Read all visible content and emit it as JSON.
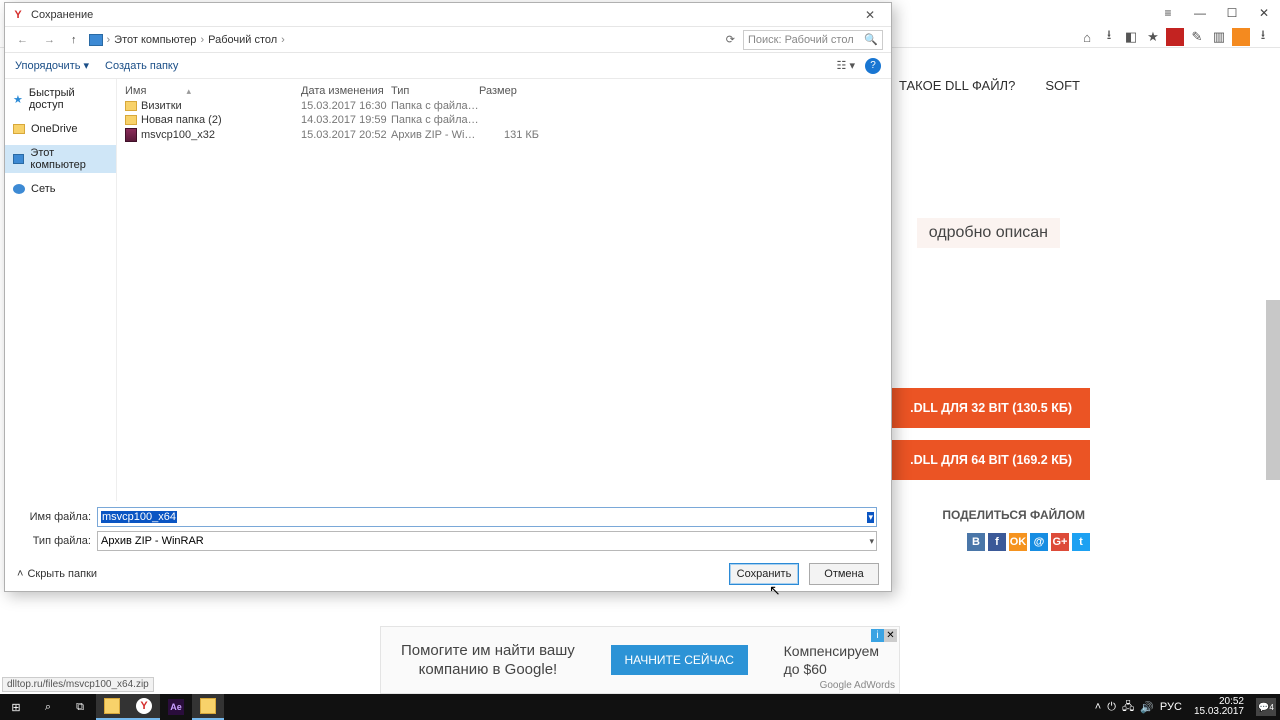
{
  "browser": {
    "controls": {
      "menu": "≡",
      "min": "—",
      "max": "☐",
      "close": "✕"
    },
    "page_nav": {
      "dll_file": "ТАКОЕ DLL ФАЙЛ?",
      "soft": "SOFT"
    },
    "page_desc": "одробно описан",
    "dl32": ".DLL ДЛЯ 32 BIT (130.5 КБ)",
    "dl64": ".DLL ДЛЯ 64 BIT (169.2 КБ)",
    "share_title": "ПОДЕЛИТЬСЯ ФАЙЛОМ",
    "status_url": "dlltop.ru/files/msvcp100_x64.zip"
  },
  "ad": {
    "line1": "Помогите им найти вашу",
    "line2": "компанию в Google!",
    "cta": "НАЧНИТЕ СЕЙЧАС",
    "right1": "Компенсируем",
    "right2": "до $60",
    "brand": "Google AdWords",
    "info": "i",
    "x": "✕"
  },
  "dialog": {
    "title": "Сохранение",
    "close": "✕",
    "nav_back": "←",
    "nav_fwd": "→",
    "nav_up": "↑",
    "refresh": "⟳",
    "crumb_pc": "Этот компьютер",
    "crumb_desktop": "Рабочий стол",
    "crumb_sep": "›",
    "search_placeholder": "Поиск: Рабочий стол",
    "search_icon": "🔍",
    "organize": "Упорядочить ▾",
    "newfolder": "Создать папку",
    "view_icon": "☷ ▾",
    "help": "?",
    "side": {
      "quick": "Быстрый доступ",
      "onedrive": "OneDrive",
      "thispc": "Этот компьютер",
      "network": "Сеть"
    },
    "columns": {
      "name": "Имя",
      "date": "Дата изменения",
      "type": "Тип",
      "size": "Размер",
      "sort": "▴"
    },
    "rows": [
      {
        "icon": "folder",
        "name": "Визитки",
        "date": "15.03.2017 16:30",
        "type": "Папка с файлами",
        "size": ""
      },
      {
        "icon": "folder",
        "name": "Новая папка (2)",
        "date": "14.03.2017 19:59",
        "type": "Папка с файлами",
        "size": ""
      },
      {
        "icon": "zip",
        "name": "msvcp100_x32",
        "date": "15.03.2017 20:52",
        "type": "Архив ZIP - WinR...",
        "size": "131 КБ"
      }
    ],
    "filename_label": "Имя файла:",
    "filename_value": "msvcp100_x64",
    "filetype_label": "Тип файла:",
    "filetype_value": "Архив ZIP - WinRAR",
    "hide_folders": "Скрыть папки",
    "hide_caret": "˄",
    "save": "Сохранить",
    "cancel": "Отмена"
  },
  "taskbar": {
    "lang": "РУС",
    "time": "20:52",
    "date": "15.03.2017",
    "notif": "4"
  }
}
